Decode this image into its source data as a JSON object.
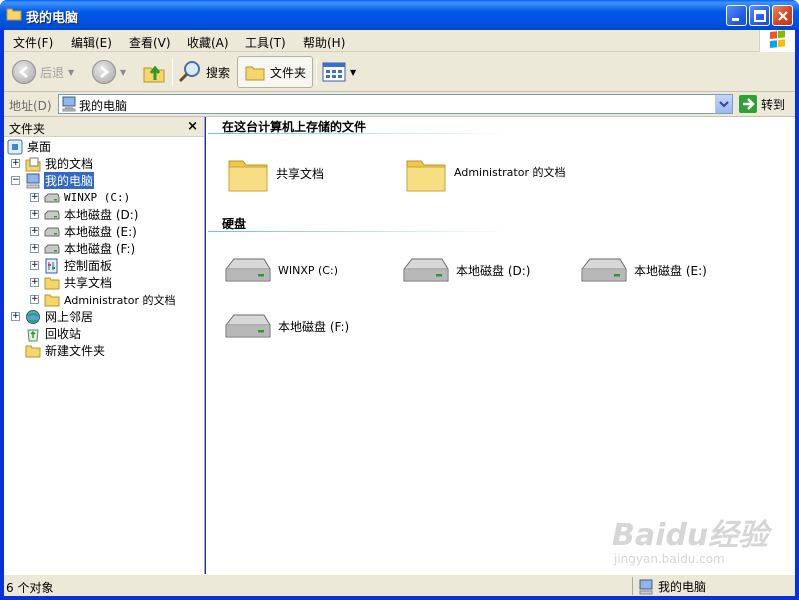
{
  "window": {
    "title": "我的电脑"
  },
  "menu": {
    "items": [
      "文件(F)",
      "编辑(E)",
      "查看(V)",
      "收藏(A)",
      "工具(T)",
      "帮助(H)"
    ]
  },
  "toolbar": {
    "back_label": "后退",
    "search_label": "搜索",
    "folders_label": "文件夹"
  },
  "address": {
    "label": "地址(D)",
    "value": "我的电脑",
    "go_label": "转到"
  },
  "folder_pane": {
    "title": "文件夹",
    "close_glyph": "×",
    "tree": [
      {
        "label": "桌面",
        "icon": "desktop-icon",
        "selected": false
      },
      {
        "label": "我的文档",
        "icon": "my-documents-icon",
        "selected": false
      },
      {
        "label": "我的电脑",
        "icon": "my-computer-icon",
        "selected": true
      },
      {
        "label": "WINXP (C:)",
        "icon": "drive-icon",
        "selected": false
      },
      {
        "label": "本地磁盘 (D:)",
        "icon": "drive-icon",
        "selected": false
      },
      {
        "label": "本地磁盘 (E:)",
        "icon": "drive-icon",
        "selected": false
      },
      {
        "label": "本地磁盘 (F:)",
        "icon": "drive-icon",
        "selected": false
      },
      {
        "label": "控制面板",
        "icon": "control-panel-icon",
        "selected": false
      },
      {
        "label": "共享文档",
        "icon": "folder-icon",
        "selected": false
      },
      {
        "label": "Administrator 的文档",
        "icon": "folder-icon",
        "selected": false
      },
      {
        "label": "网上邻居",
        "icon": "network-icon",
        "selected": false
      },
      {
        "label": "回收站",
        "icon": "recycle-bin-icon",
        "selected": false
      },
      {
        "label": "新建文件夹",
        "icon": "folder-icon",
        "selected": false
      }
    ]
  },
  "content": {
    "stored_group_title": "在这台计算机上存储的文件",
    "stored_items": [
      "共享文档",
      "Administrator 的文档"
    ],
    "drives_group_title": "硬盘",
    "drives": [
      "WINXP (C:)",
      "本地磁盘 (D:)",
      "本地磁盘 (E:)",
      "本地磁盘 (F:)"
    ]
  },
  "status": {
    "left": "6 个对象",
    "right": "我的电脑"
  },
  "watermark": {
    "brand": "Baidu经验",
    "url": "jingyan.baidu.com"
  },
  "colors": {
    "title_blue": "#0054e3",
    "chrome": "#ece9d8",
    "selection": "#316ac5",
    "folder_yellow": "#f5d66a"
  }
}
